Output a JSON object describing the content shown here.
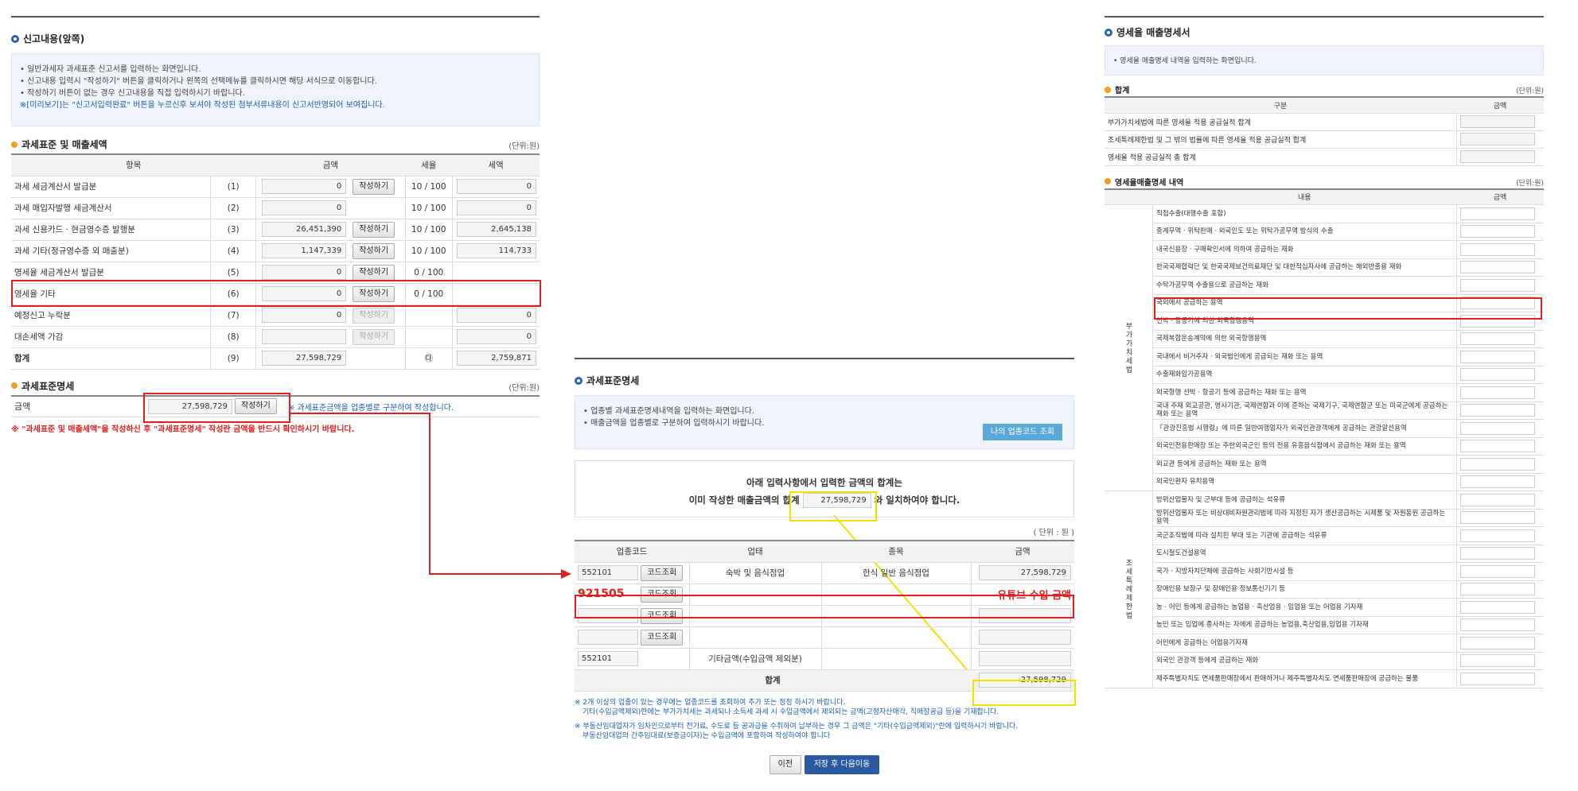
{
  "left": {
    "section1_title": "신고내용(앞쪽)",
    "info_lines": [
      "• 일반과세자 과세표준 신고서를 입력하는 화면입니다.",
      "• 신고내용 입력시 \"작성하기\" 버튼을 클릭하거나 왼쪽의 선택메뉴를 클릭하시면 해당 서식으로 이동합니다.",
      "• 작성하기 버튼이 없는 경우 신고내용을 직접 입력하시기 바랍니다.",
      "※[미리보기]는 \"신고서입력완료\" 버튼을 누르신후 보셔야 작성된 첨부서류내용이 신고서반영되어 보여집니다."
    ],
    "section2_title": "과세표준 및 매출세액",
    "unit": "(단위:원)",
    "headers": [
      "항목",
      "금액",
      "세율",
      "세액"
    ],
    "write_label": "작성하기",
    "rows": [
      {
        "label": "과세 세금계산서 발급분",
        "no": "(1)",
        "amount": "0",
        "btn": true,
        "rate": "10 / 100",
        "tax": "0"
      },
      {
        "label": "과세 매입자발행 세금계산서",
        "no": "(2)",
        "amount": "0",
        "btn": false,
        "rate": "10 / 100",
        "tax": "0"
      },
      {
        "label": "과세 신용카드 · 현금영수증 발행분",
        "no": "(3)",
        "amount": "26,451,390",
        "btn": true,
        "rate": "10 / 100",
        "tax": "2,645,138"
      },
      {
        "label": "과세 기타(정규영수증 외 매출분)",
        "no": "(4)",
        "amount": "1,147,339",
        "btn": true,
        "rate": "10 / 100",
        "tax": "114,733"
      },
      {
        "label": "영세율 세금계산서 발급분",
        "no": "(5)",
        "amount": "0",
        "btn": true,
        "rate": "0 / 100",
        "tax": ""
      },
      {
        "label": "영세율 기타",
        "no": "(6)",
        "amount": "0",
        "btn": true,
        "rate": "0 / 100",
        "tax": ""
      },
      {
        "label": "예정신고 누락분",
        "no": "(7)",
        "amount": "0",
        "btn": "dis",
        "rate": "",
        "tax": "0"
      },
      {
        "label": "대손세액 가감",
        "no": "(8)",
        "amount": "",
        "btn": "dis",
        "rate": "",
        "tax": "0"
      },
      {
        "label": "합계",
        "no": "(9)",
        "amount": "27,598,729",
        "btn": false,
        "rate": "㉰",
        "tax": "2,759,871"
      }
    ],
    "section3_title": "과세표준명세",
    "section3_unit": "(단위:원)",
    "amount_label": "금액",
    "amount_value": "27,598,729",
    "amount_note": "※ 과세표준금액을 업종별로 구분하여 작성합니다.",
    "warning": "※ \"과세표준 및 매출세액\"을 작성하신 후 \"과세표준명세\" 작성란 금액을 반드시 확인하시기 바랍니다."
  },
  "middle": {
    "title": "과세표준명세",
    "info_lines": [
      "• 업종별 과세표준명세내역을 입력하는 화면입니다.",
      "• 매출금액을 업종별로 구분하여 입력하시기 바랍니다."
    ],
    "lookup_btn": "나의 업종코드 조회",
    "notice_line1": "아래 입력사항에서 입력한 금액의 합계는",
    "notice_line2a": "이미 작성한 매출금액의 합계",
    "notice_amount": "27,598,729",
    "notice_line2b": "와 일치하여야 합니다.",
    "unit": "( 단위 : 원 )",
    "headers": [
      "업종코드",
      "업태",
      "종목",
      "금액"
    ],
    "code_btn": "코드조회",
    "rows": [
      {
        "code": "552101",
        "type": "숙박 및 음식점업",
        "item": "한식 일반 음식점업",
        "amount": "27,598,729"
      },
      {
        "code": "921505",
        "type": "",
        "item": "",
        "amount": "유튜브 수입 금액"
      },
      {
        "code": "",
        "type": "",
        "item": "",
        "amount": ""
      },
      {
        "code": "",
        "type": "",
        "item": "",
        "amount": ""
      },
      {
        "code": "552101",
        "type": "기타금액(수입금액 제외분)",
        "item": "",
        "amount": ""
      }
    ],
    "total_label": "합계",
    "total_value": "27,598,729",
    "notes": [
      "※ 2개 이상의 업종이 있는 경우에는 업종코드를 조회하여 추가 또는 정정 하시기 바랍니다.",
      "기타(수입금액제외)란에는 부가가치세는 과세되나 소득세 과세 시 수입금액에서 제외되는 금액(고정자산매각, 직매장공급 등)을 기재합니다.",
      "※ 부동산임대업자가 임차인으로부터 전기료, 수도료 등 공과금을 수취하여 납부하는 경우 그 금액은 \"기타(수입금액제외)\"란에 입력하시기 바랍니다.",
      "부동산임대업의 간주임대료(보증금이자)는 수입금액에 포함하여 작성하여야 합니다"
    ],
    "prev_btn": "이전",
    "save_btn": "저장 후 다음이동"
  },
  "right": {
    "title": "영세율 매출명세서",
    "info": "• 영세율 매출명세 내역을 입력하는 화면입니다.",
    "sum_title": "합계",
    "unit": "(단위:원)",
    "sum_headers": [
      "구분",
      "금액"
    ],
    "sum_rows": [
      "부가가치세법에 따른 영세율 적용 공급실적 합계",
      "조세특례제한법 및 그 밖의 법률에 따른 영세율 적용 공급실적 합계",
      "영세율 적용 공급실적 총 합계"
    ],
    "detail_title": "영세율매출명세 내역",
    "detail_unit": "(단위:원)",
    "detail_headers": [
      "내용",
      "금액"
    ],
    "group1": "부가가치세법",
    "group1_rows": [
      "직접수출(대행수출 포함)",
      "중계무역 · 위탁판매 · 외국인도 또는 위탁가공무역 방식의 수출",
      "내국신용장 · 구매확인서에 의하여 공급하는 재화",
      "한국국제협력단 및 한국국제보건의료재단 및 대한적십자사에 공급하는 해외반출용 재화",
      "수탁가공무역 수출용으로 공급하는 재화",
      "국외에서 공급하는 용역",
      "선박 · 항공기에 의한 외국항행용역",
      "국제복합운송계약에 의한 외국항행용역",
      "국내에서 비거주자 · 외국법인에게 공급되는 재화 또는 용역",
      "수출재화임가공용역",
      "외국항행 선박 · 항공기 등에 공급하는 재화 또는 용역",
      "국내 주재 외교공관, 영사기관, 국제연합과 이에 준하는 국제기구, 국제연합군 또는 미국군에게 공급하는 재화 또는 용역",
      "「관광진흥법 시행령」에 따른 일반여행업자가 외국인관광객에게 공급하는 관광알선용역",
      "외국인전용판매장 또는 주한외국군인 등의 전용 유흥음식점에서 공급하는 재화 또는 용역",
      "외교관 등에게 공급하는 재화 또는 용역",
      "외국인환자 유치용역"
    ],
    "group2": "조세특례제한법",
    "group2_rows": [
      "방위산업물자 및 군부대 등에 공급하는 석유류",
      "방위산업물자 또는 비상대비자원관리법에 따라 지정된 자가 생산공급하는 시제품 및 자원동원 공급하는 용역",
      "국군조직법에 따라 설치된 부대 또는 기관에 공급하는 석유류",
      "도시철도건설용역",
      "국가 · 지방자치단체에 공급하는 사회기반시설 등",
      "장애인용 보장구 및 장애인용 정보통신기기 등",
      "농 · 어민 등에게 공급하는 농업용 · 축산업용 · 임업용 또는 어업용 기자재",
      "농민 또는 임업에 종사하는 자에게 공급하는 농업용,축산업용,임업용 기자재",
      "어민에게 공급하는 어업용기자재",
      "외국인 관광객 등에게 공급하는 재화",
      "제주특별자치도 면세품판매장에서 판매하거나 제주특별자치도 면세품판매장에 공급하는 물품"
    ]
  },
  "colors": {
    "red": "#e02020",
    "yellow": "#f5e000",
    "blue_btn": "#2c5aa0",
    "lookup_btn": "#5aa8d8"
  }
}
